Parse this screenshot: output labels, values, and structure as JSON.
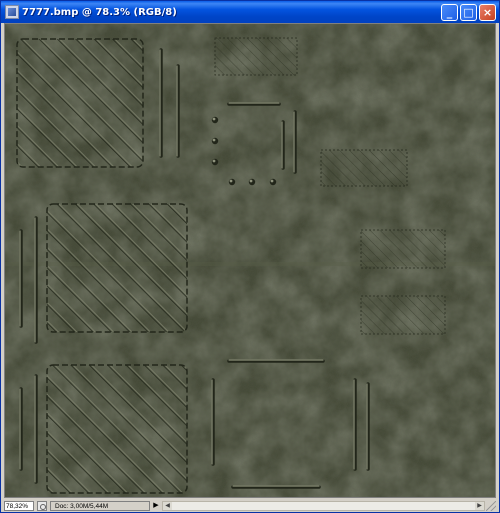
{
  "window": {
    "title": "7777.bmp @ 78.3% (RGB/8)",
    "minimize_label": "_",
    "maximize_label": "□",
    "close_label": "×"
  },
  "colors": {
    "titlebar": "#0454e0",
    "texture_base": "#434935",
    "texture_light": "#5a5f49",
    "embossed_line_light": "#8a8e78",
    "embossed_line_dark": "#23271b"
  },
  "status": {
    "zoom": "78,32%",
    "doc": "Doc: 3,00M/5,44M",
    "menu_arrow": "▶"
  },
  "icons": {
    "app": "photoshop-document-icon",
    "status": "status-info-icon"
  }
}
